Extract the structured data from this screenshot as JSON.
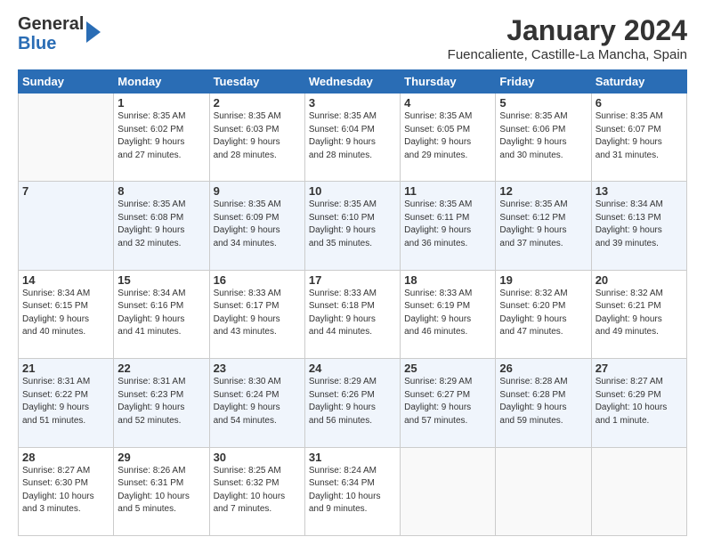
{
  "logo": {
    "line1": "General",
    "line2": "Blue"
  },
  "header": {
    "month": "January 2024",
    "location": "Fuencaliente, Castille-La Mancha, Spain"
  },
  "weekdays": [
    "Sunday",
    "Monday",
    "Tuesday",
    "Wednesday",
    "Thursday",
    "Friday",
    "Saturday"
  ],
  "weeks": [
    [
      {
        "day": "",
        "info": ""
      },
      {
        "day": "1",
        "info": "Sunrise: 8:35 AM\nSunset: 6:02 PM\nDaylight: 9 hours\nand 27 minutes."
      },
      {
        "day": "2",
        "info": "Sunrise: 8:35 AM\nSunset: 6:03 PM\nDaylight: 9 hours\nand 28 minutes."
      },
      {
        "day": "3",
        "info": "Sunrise: 8:35 AM\nSunset: 6:04 PM\nDaylight: 9 hours\nand 28 minutes."
      },
      {
        "day": "4",
        "info": "Sunrise: 8:35 AM\nSunset: 6:05 PM\nDaylight: 9 hours\nand 29 minutes."
      },
      {
        "day": "5",
        "info": "Sunrise: 8:35 AM\nSunset: 6:06 PM\nDaylight: 9 hours\nand 30 minutes."
      },
      {
        "day": "6",
        "info": "Sunrise: 8:35 AM\nSunset: 6:07 PM\nDaylight: 9 hours\nand 31 minutes."
      }
    ],
    [
      {
        "day": "7",
        "info": ""
      },
      {
        "day": "8",
        "info": "Sunrise: 8:35 AM\nSunset: 6:08 PM\nDaylight: 9 hours\nand 32 minutes."
      },
      {
        "day": "9",
        "info": "Sunrise: 8:35 AM\nSunset: 6:09 PM\nDaylight: 9 hours\nand 34 minutes."
      },
      {
        "day": "10",
        "info": "Sunrise: 8:35 AM\nSunset: 6:10 PM\nDaylight: 9 hours\nand 35 minutes."
      },
      {
        "day": "11",
        "info": "Sunrise: 8:35 AM\nSunset: 6:11 PM\nDaylight: 9 hours\nand 36 minutes."
      },
      {
        "day": "12",
        "info": "Sunrise: 8:35 AM\nSunset: 6:12 PM\nDaylight: 9 hours\nand 37 minutes."
      },
      {
        "day": "13",
        "info": "Sunrise: 8:34 AM\nSunset: 6:13 PM\nDaylight: 9 hours\nand 39 minutes."
      }
    ],
    [
      {
        "day": "14",
        "info": "Sunrise: 8:34 AM\nSunset: 6:15 PM\nDaylight: 9 hours\nand 40 minutes."
      },
      {
        "day": "15",
        "info": "Sunrise: 8:34 AM\nSunset: 6:16 PM\nDaylight: 9 hours\nand 41 minutes."
      },
      {
        "day": "16",
        "info": "Sunrise: 8:33 AM\nSunset: 6:17 PM\nDaylight: 9 hours\nand 43 minutes."
      },
      {
        "day": "17",
        "info": "Sunrise: 8:33 AM\nSunset: 6:18 PM\nDaylight: 9 hours\nand 44 minutes."
      },
      {
        "day": "18",
        "info": "Sunrise: 8:33 AM\nSunset: 6:19 PM\nDaylight: 9 hours\nand 46 minutes."
      },
      {
        "day": "19",
        "info": "Sunrise: 8:32 AM\nSunset: 6:20 PM\nDaylight: 9 hours\nand 47 minutes."
      },
      {
        "day": "20",
        "info": "Sunrise: 8:32 AM\nSunset: 6:21 PM\nDaylight: 9 hours\nand 49 minutes."
      }
    ],
    [
      {
        "day": "21",
        "info": "Sunrise: 8:31 AM\nSunset: 6:22 PM\nDaylight: 9 hours\nand 51 minutes."
      },
      {
        "day": "22",
        "info": "Sunrise: 8:31 AM\nSunset: 6:23 PM\nDaylight: 9 hours\nand 52 minutes."
      },
      {
        "day": "23",
        "info": "Sunrise: 8:30 AM\nSunset: 6:24 PM\nDaylight: 9 hours\nand 54 minutes."
      },
      {
        "day": "24",
        "info": "Sunrise: 8:29 AM\nSunset: 6:26 PM\nDaylight: 9 hours\nand 56 minutes."
      },
      {
        "day": "25",
        "info": "Sunrise: 8:29 AM\nSunset: 6:27 PM\nDaylight: 9 hours\nand 57 minutes."
      },
      {
        "day": "26",
        "info": "Sunrise: 8:28 AM\nSunset: 6:28 PM\nDaylight: 9 hours\nand 59 minutes."
      },
      {
        "day": "27",
        "info": "Sunrise: 8:27 AM\nSunset: 6:29 PM\nDaylight: 10 hours\nand 1 minute."
      }
    ],
    [
      {
        "day": "28",
        "info": "Sunrise: 8:27 AM\nSunset: 6:30 PM\nDaylight: 10 hours\nand 3 minutes."
      },
      {
        "day": "29",
        "info": "Sunrise: 8:26 AM\nSunset: 6:31 PM\nDaylight: 10 hours\nand 5 minutes."
      },
      {
        "day": "30",
        "info": "Sunrise: 8:25 AM\nSunset: 6:32 PM\nDaylight: 10 hours\nand 7 minutes."
      },
      {
        "day": "31",
        "info": "Sunrise: 8:24 AM\nSunset: 6:34 PM\nDaylight: 10 hours\nand 9 minutes."
      },
      {
        "day": "",
        "info": ""
      },
      {
        "day": "",
        "info": ""
      },
      {
        "day": "",
        "info": ""
      }
    ]
  ]
}
